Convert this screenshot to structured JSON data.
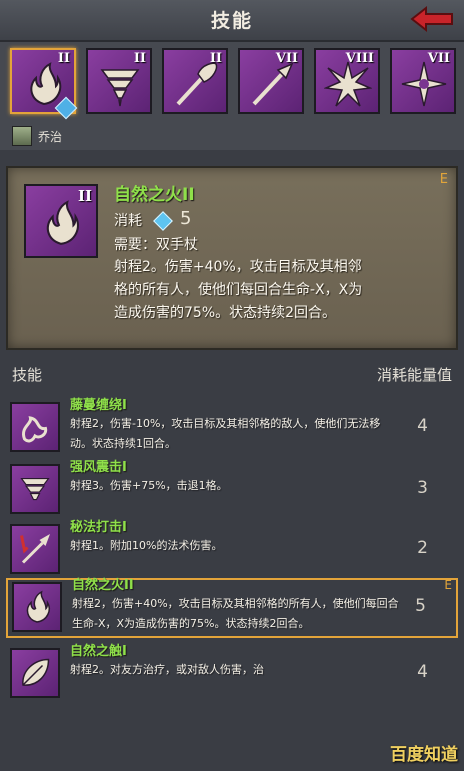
{
  "header": {
    "title": "技能"
  },
  "skillbar": {
    "slots": [
      {
        "level": "II",
        "icon": "flame-icon",
        "selected": true
      },
      {
        "level": "II",
        "icon": "whirlwind-icon",
        "selected": false
      },
      {
        "level": "II",
        "icon": "nature-spear-icon",
        "selected": false
      },
      {
        "level": "VII",
        "icon": "arcane-spear-icon",
        "selected": false
      },
      {
        "level": "VIII",
        "icon": "burst-icon",
        "selected": false
      },
      {
        "level": "VII",
        "icon": "radiant-star-icon",
        "selected": false
      }
    ],
    "gem_badge_value": "5",
    "hero_name": "乔治"
  },
  "detail": {
    "level": "II",
    "title": "自然之火II",
    "e_mark": "E",
    "cost_label": "消耗",
    "cost_value": "5",
    "requires": "需要：双手杖",
    "desc": "射程2。伤害+40%，攻击目标及其相邻格的所有人，使他们每回合生命-X，X为造成伤害的75%。状态持续2回合。"
  },
  "list": {
    "header_left": "技能",
    "header_right": "消耗能量值",
    "items": [
      {
        "name": "藤蔓缠绕I",
        "desc": "射程2，伤害-10%，攻击目标及其相邻格的敌人，使他们无法移动。状态持续1回合。",
        "cost": "4",
        "icon": "vine-icon",
        "selected": false
      },
      {
        "name": "强风震击I",
        "desc": "射程3。伤害+75%，击退1格。",
        "cost": "3",
        "icon": "whirlwind-icon",
        "selected": false
      },
      {
        "name": "秘法打击I",
        "desc": "射程1。附加10%的法术伤害。",
        "cost": "2",
        "icon": "arcane-strike-icon",
        "selected": false
      },
      {
        "name": "自然之火II",
        "desc": "射程2，伤害+40%，攻击目标及其相邻格的所有人，使他们每回合生命-X，X为造成伤害的75%。状态持续2回合。",
        "cost": "5",
        "icon": "flame-icon",
        "selected": true,
        "e_mark": "E"
      },
      {
        "name": "自然之触I",
        "desc": "射程2。对友方治疗，或对敌人伤害，治",
        "cost": "4",
        "icon": "leaf-icon",
        "selected": false
      }
    ]
  },
  "watermark": "百度知道",
  "colors": {
    "accent": "#e3a43a",
    "skill_name": "#8fe04a",
    "icon_bg": "#7a3590"
  }
}
